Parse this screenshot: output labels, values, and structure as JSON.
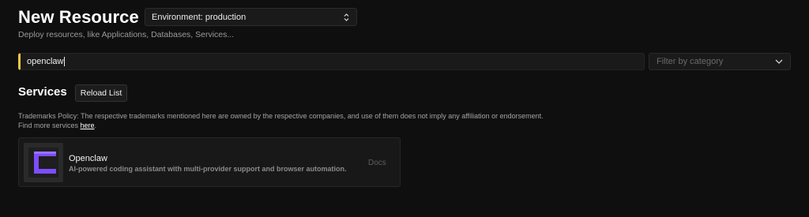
{
  "header": {
    "title": "New Resource",
    "subtitle": "Deploy resources, like Applications, Databases, Services...",
    "environment_select": {
      "value": "Environment: production",
      "icon": "up-down-chevron-icon"
    }
  },
  "search": {
    "value": "openclaw",
    "accent_color": "#f5c542"
  },
  "filter": {
    "placeholder": "Filter by category",
    "icon": "chevron-down-icon"
  },
  "services_section": {
    "title": "Services",
    "reload_label": "Reload List",
    "policy_text": "Trademarks Policy: The respective trademarks mentioned here are owned by the respective companies, and use of them does not imply any affiliation or endorsement.",
    "find_more_prefix": "Find more services ",
    "find_more_link": "here",
    "find_more_suffix": "."
  },
  "services": [
    {
      "name": "Openclaw",
      "description": "AI-powered coding assistant with multi-provider support and browser automation.",
      "docs_label": "Docs",
      "logo_icon": "openclaw-logo-icon",
      "logo_color": "#7c4dff"
    }
  ]
}
